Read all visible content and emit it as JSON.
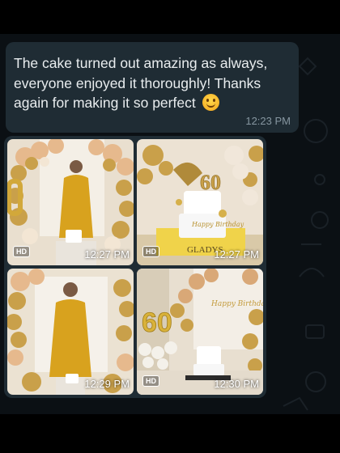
{
  "message": {
    "text": "The cake turned out amazing as always, everyone enjoyed it thoroughly! Thanks again for making it so perfect",
    "emoji": "smiling-face-icon",
    "time": "12:23 PM"
  },
  "photos": [
    {
      "time": "12:27 PM",
      "badge": "HD"
    },
    {
      "time": "12:27 PM",
      "badge": "HD",
      "cake_number": "60",
      "cake_plaque": "GLADYS",
      "cake_script": "Happy Birthday"
    },
    {
      "time": "12:29 PM",
      "badge": ""
    },
    {
      "time": "12:30 PM",
      "badge": "HD",
      "balloon_number": "60",
      "sign": "Happy Birthday"
    }
  ],
  "colors": {
    "chat_background": "#0b1014",
    "bubble": "#1f2c34",
    "text": "#e9edef",
    "timestamp": "#8696a0"
  }
}
